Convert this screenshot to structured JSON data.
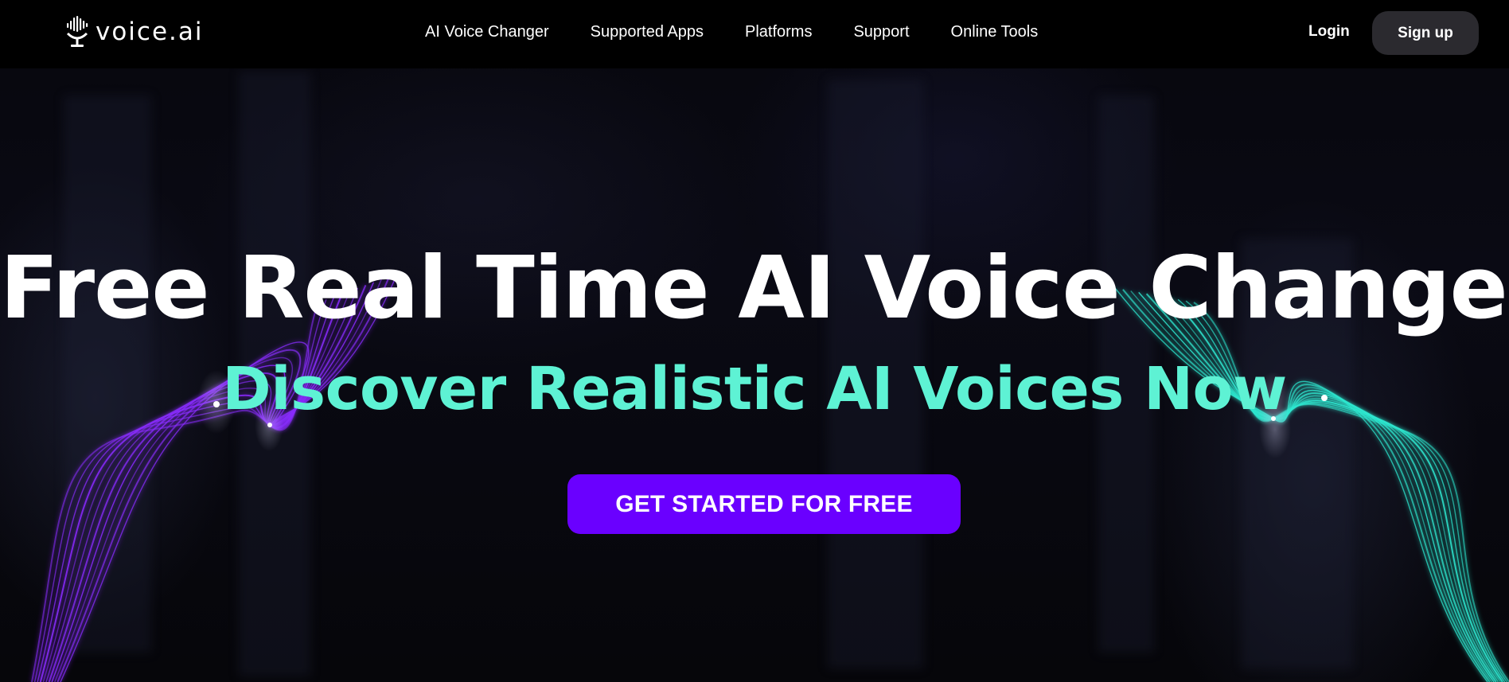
{
  "brand": {
    "name": "voice.ai",
    "logo_icon": "microphone-waveform-icon"
  },
  "nav": {
    "links": [
      {
        "label": "AI Voice Changer"
      },
      {
        "label": "Supported Apps"
      },
      {
        "label": "Platforms"
      },
      {
        "label": "Support"
      },
      {
        "label": "Online Tools"
      }
    ],
    "login_label": "Login",
    "signup_label": "Sign up"
  },
  "hero": {
    "title": "Free Real Time AI Voice Changer",
    "subtitle": "Discover Realistic AI Voices Now",
    "cta_label": "GET STARTED FOR FREE"
  },
  "colors": {
    "background": "#000000",
    "accent_purple": "#6a00ff",
    "accent_teal": "#5ef2d4",
    "signup_button_bg": "#2b2a2f",
    "wave_left": "#8a2cff",
    "wave_right": "#2ee8d0"
  }
}
